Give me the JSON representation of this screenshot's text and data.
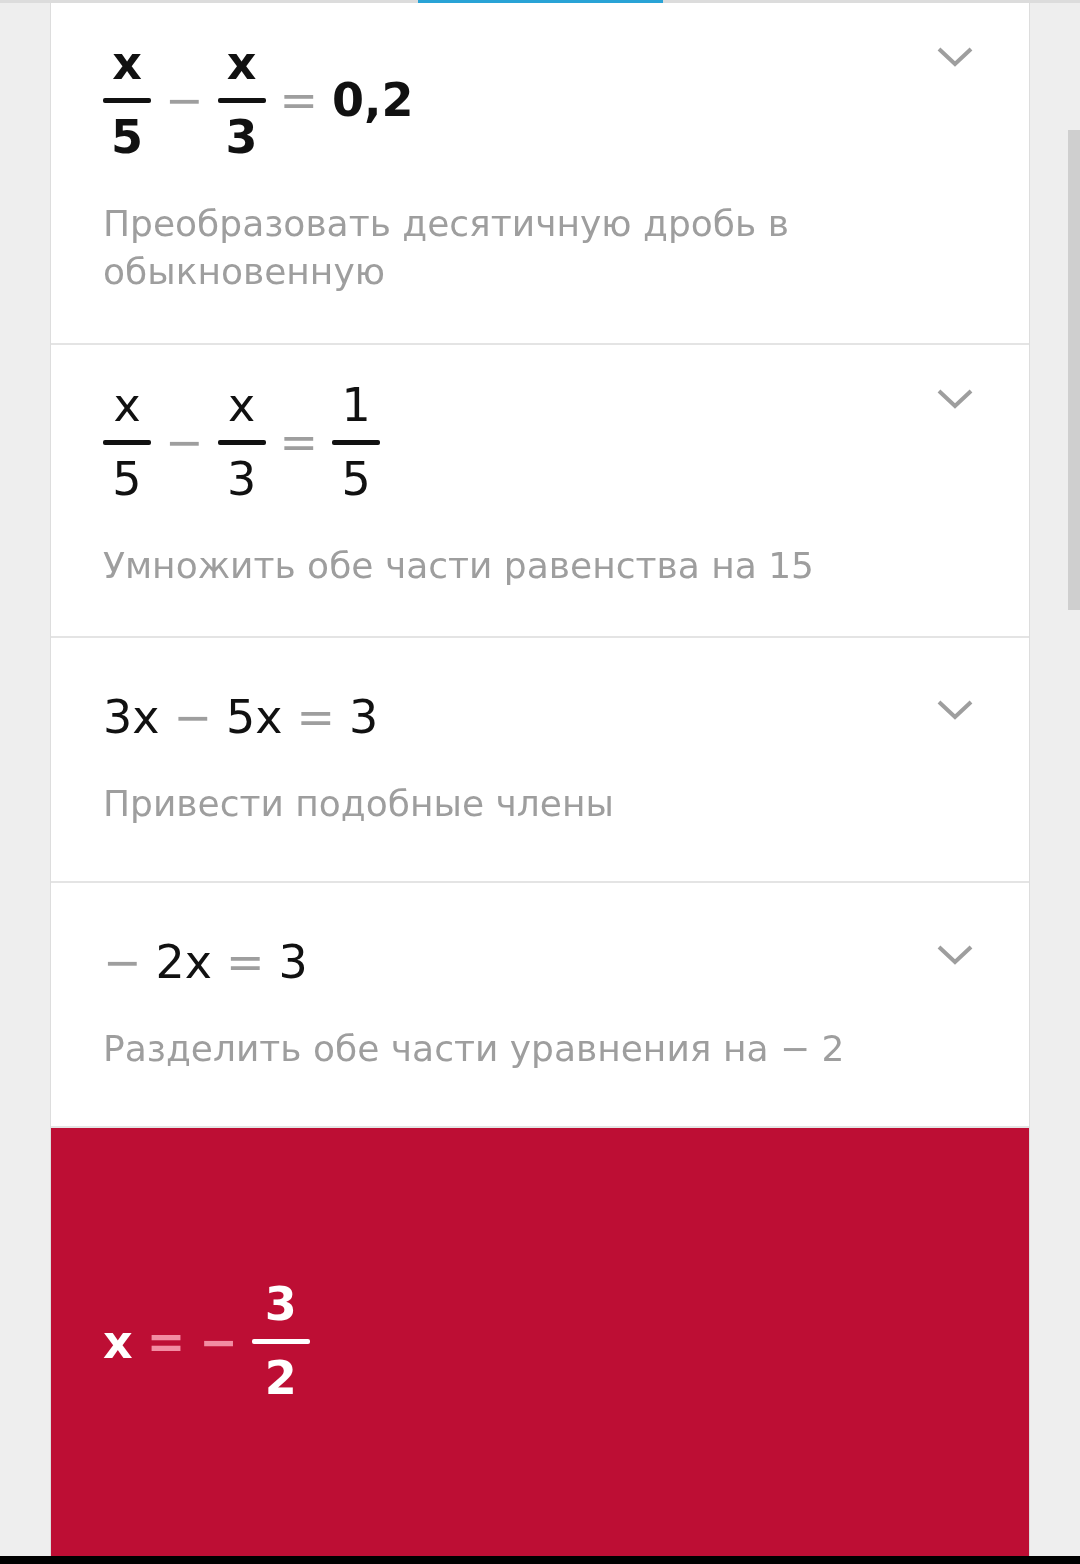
{
  "steps": [
    {
      "emphasized": true,
      "expression": [
        {
          "kind": "frac",
          "num": "x",
          "den": "5"
        },
        {
          "kind": "op",
          "text": "−"
        },
        {
          "kind": "frac",
          "num": "x",
          "den": "3"
        },
        {
          "kind": "op",
          "text": "="
        },
        {
          "kind": "term",
          "text": "0,2"
        }
      ],
      "hint": "Преобразовать десятичную дробь в обыкновенную"
    },
    {
      "emphasized": false,
      "expression": [
        {
          "kind": "frac",
          "num": "x",
          "den": "5"
        },
        {
          "kind": "op",
          "text": "−"
        },
        {
          "kind": "frac",
          "num": "x",
          "den": "3"
        },
        {
          "kind": "op",
          "text": "="
        },
        {
          "kind": "frac",
          "num": "1",
          "den": "5"
        }
      ],
      "hint": "Умножить обе части равенства на 15"
    },
    {
      "emphasized": false,
      "expression": [
        {
          "kind": "term",
          "text": "3x"
        },
        {
          "kind": "op",
          "text": "−"
        },
        {
          "kind": "term",
          "text": "5x"
        },
        {
          "kind": "op",
          "text": "="
        },
        {
          "kind": "term",
          "text": "3"
        }
      ],
      "hint": "Привести подобные члены"
    },
    {
      "emphasized": false,
      "expression": [
        {
          "kind": "op",
          "text": "−"
        },
        {
          "kind": "term",
          "text": "2x"
        },
        {
          "kind": "op",
          "text": "="
        },
        {
          "kind": "term",
          "text": "3"
        }
      ],
      "hint": "Разделить обе части уравнения на − 2"
    }
  ],
  "answer": {
    "expression": [
      {
        "kind": "term",
        "text": "x"
      },
      {
        "kind": "op",
        "text": "="
      },
      {
        "kind": "op",
        "text": "−"
      },
      {
        "kind": "frac",
        "num": "3",
        "den": "2"
      }
    ]
  }
}
